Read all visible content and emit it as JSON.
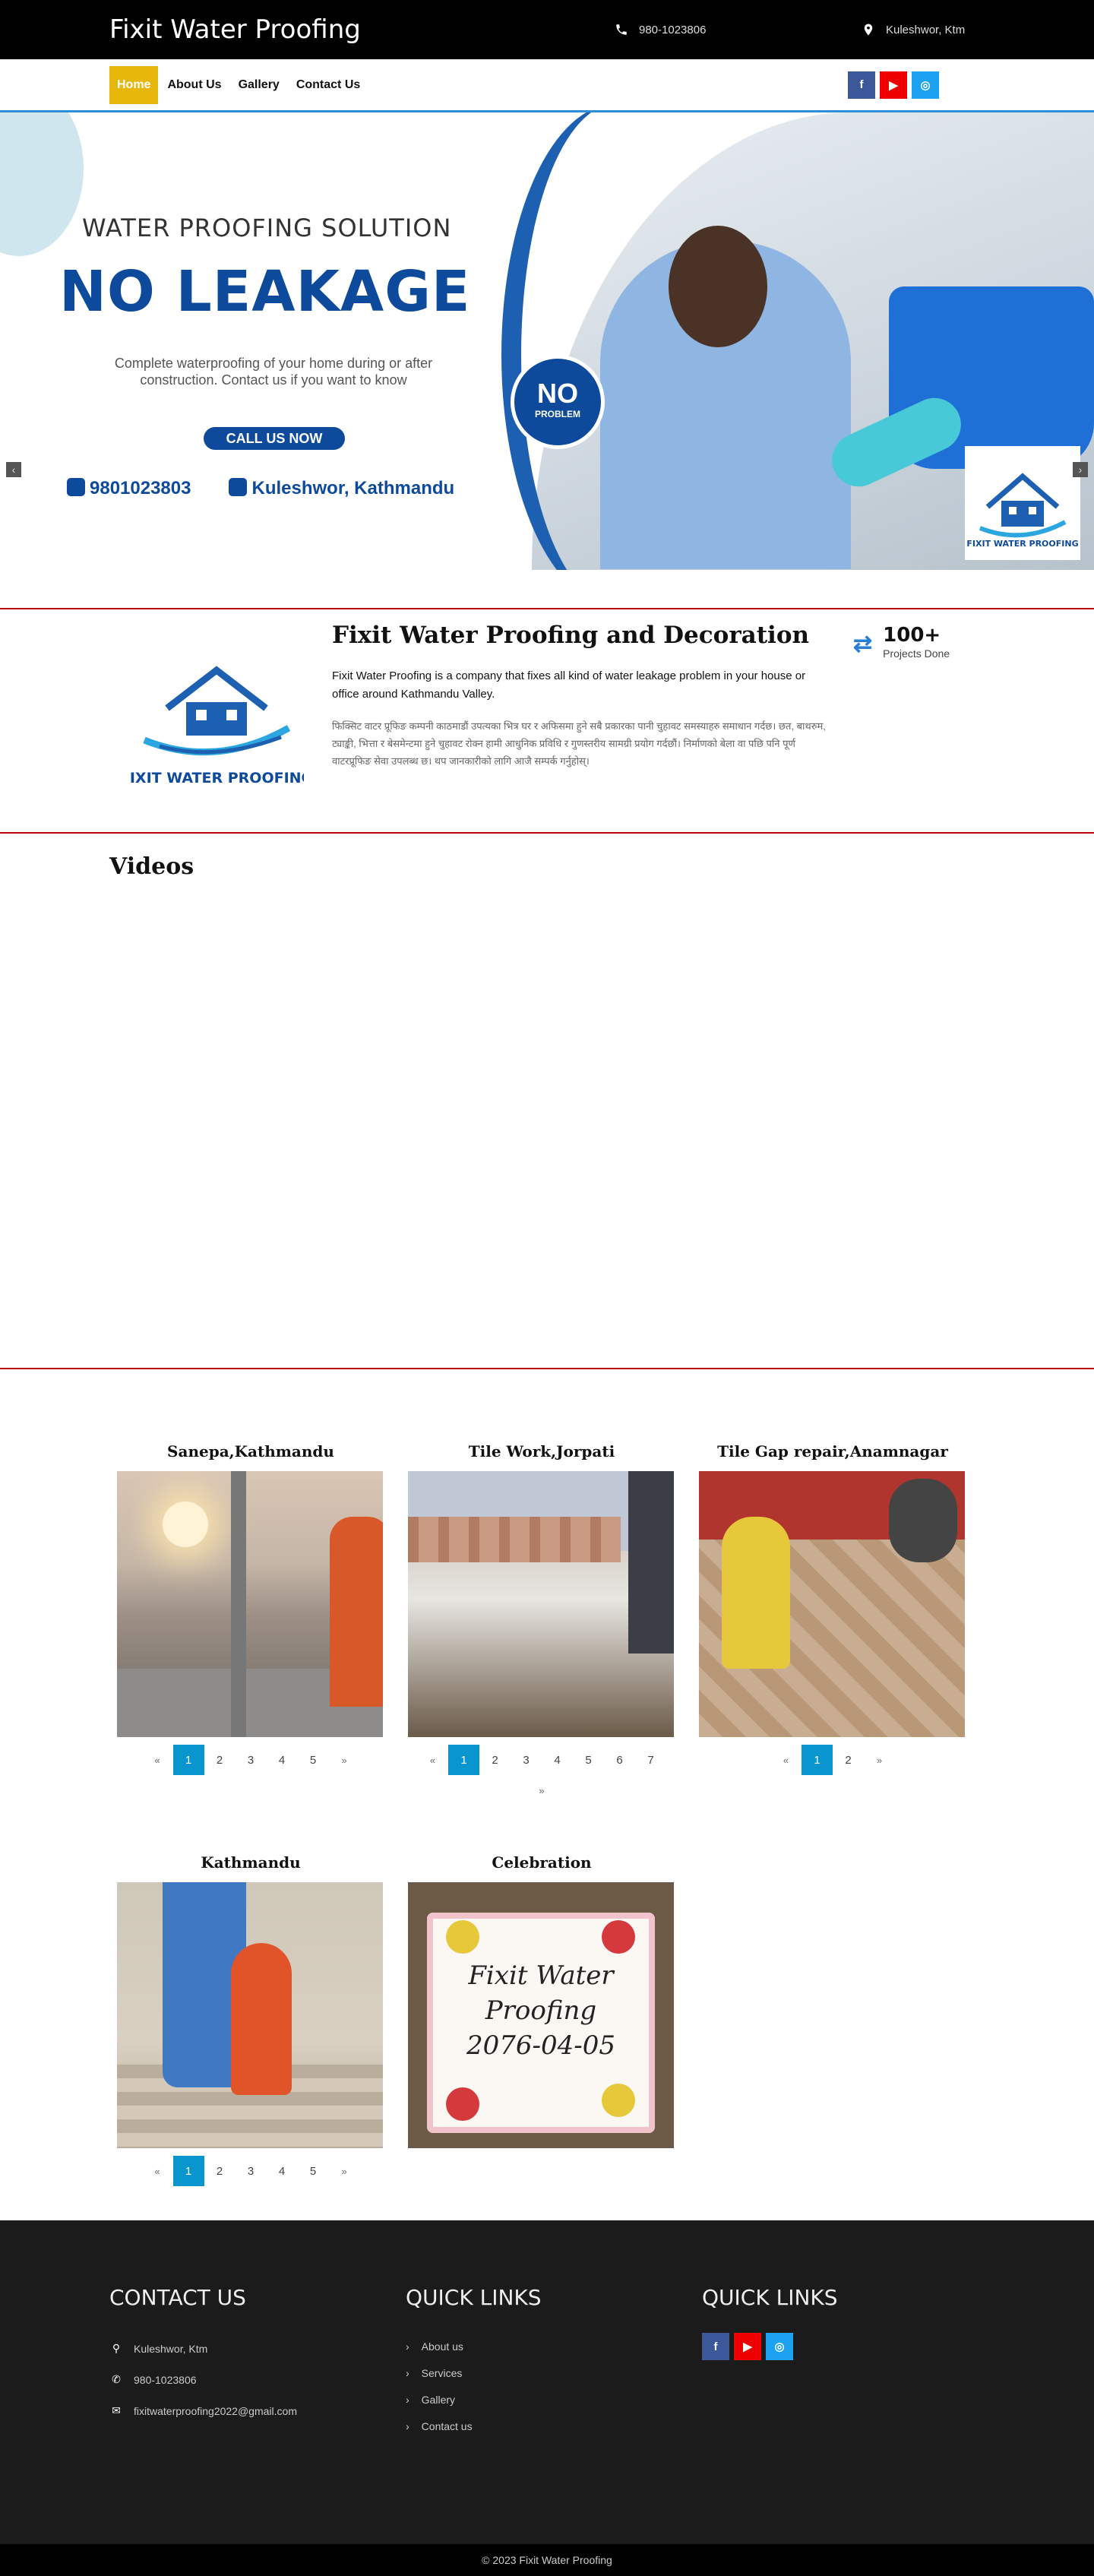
{
  "header": {
    "brand": "Fixit Water Proofing",
    "phone": "980-1023806",
    "location": "Kuleshwor, Ktm"
  },
  "nav": {
    "items": [
      {
        "label": "Home",
        "active": true
      },
      {
        "label": "About Us",
        "active": false
      },
      {
        "label": "Gallery",
        "active": false
      },
      {
        "label": "Contact Us",
        "active": false
      }
    ],
    "social_icons": [
      "facebook-icon",
      "youtube-icon",
      "instagram-icon"
    ]
  },
  "hero": {
    "subtitle": "WATER PROOFING SOLUTION",
    "title": "NO LEAKAGE",
    "description": "Complete waterproofing of your home during or after construction. Contact us if you want to know",
    "cta": "CALL US NOW",
    "phone": "9801023803",
    "address": "Kuleshwor, Kathmandu",
    "badge_big": "NO",
    "badge_small": "PROBLEM",
    "logo_text": "FIXIT WATER PROOFING",
    "slide_count": 3,
    "active_slide": 2
  },
  "about": {
    "title": "Fixit Water Proofing and Decoration",
    "text": "Fixit Water Proofing is a company that fixes all kind of water leakage problem in your house or office around Kathmandu Valley.",
    "text_secondary": "फिक्सिट वाटर प्रूफिङ कम्पनी काठमाडौं उपत्यका भित्र घर र अफिसमा हुने सबै प्रकारका पानी चुहावट समस्याहरु समाधान गर्दछ। छत, बाथरुम, ट्याङ्की, भित्ता र बेसमेन्टमा हुने चुहावट रोक्न हामी आधुनिक प्रविधि र गुणस्तरीय सामग्री प्रयोग गर्दछौं। निर्माणको बेला वा पछि पनि पूर्ण वाटरप्रूफिङ सेवा उपलब्ध छ। थप जानकारीको लागि आजै सम्पर्क गर्नुहोस्।",
    "logo_text": "FIXIT WATER PROOFING",
    "stat_number": "100+",
    "stat_label": "Projects Done"
  },
  "videos": {
    "heading": "Videos"
  },
  "gallery": {
    "albums": [
      {
        "title": "Sanepa,Kathmandu",
        "pages": [
          "1",
          "2",
          "3",
          "4",
          "5"
        ]
      },
      {
        "title": "Tile Work,Jorpati",
        "pages": [
          "1",
          "2",
          "3",
          "4",
          "5",
          "6",
          "7"
        ]
      },
      {
        "title": "Tile Gap repair,Anamnagar",
        "pages": [
          "1",
          "2"
        ]
      },
      {
        "title": "Kathmandu",
        "pages": [
          "1",
          "2",
          "3",
          "4",
          "5"
        ]
      },
      {
        "title": "Celebration",
        "pages": []
      }
    ],
    "prev": "«",
    "next": "»",
    "cake_text": "Fixit Water Proofing 2076-04-05"
  },
  "footer": {
    "contact_heading": "CONTACT US",
    "contact": {
      "address": "Kuleshwor, Ktm",
      "phone": "980-1023806",
      "email": "fixitwaterproofing2022@gmail.com"
    },
    "links_heading": "QUICK LINKS",
    "links": [
      "About us",
      "Services",
      "Gallery",
      "Contact us"
    ],
    "social_heading": "QUICK LINKS",
    "copyright": "© 2023 Fixit Water Proofing"
  },
  "colors": {
    "accent": "#e5b80b",
    "brand_blue": "#0e4a9c",
    "pager_active": "#0996cf",
    "divider": "#bb0000",
    "facebook": "#3b5998",
    "youtube": "#ee0000",
    "instagram": "#1da1f2"
  }
}
